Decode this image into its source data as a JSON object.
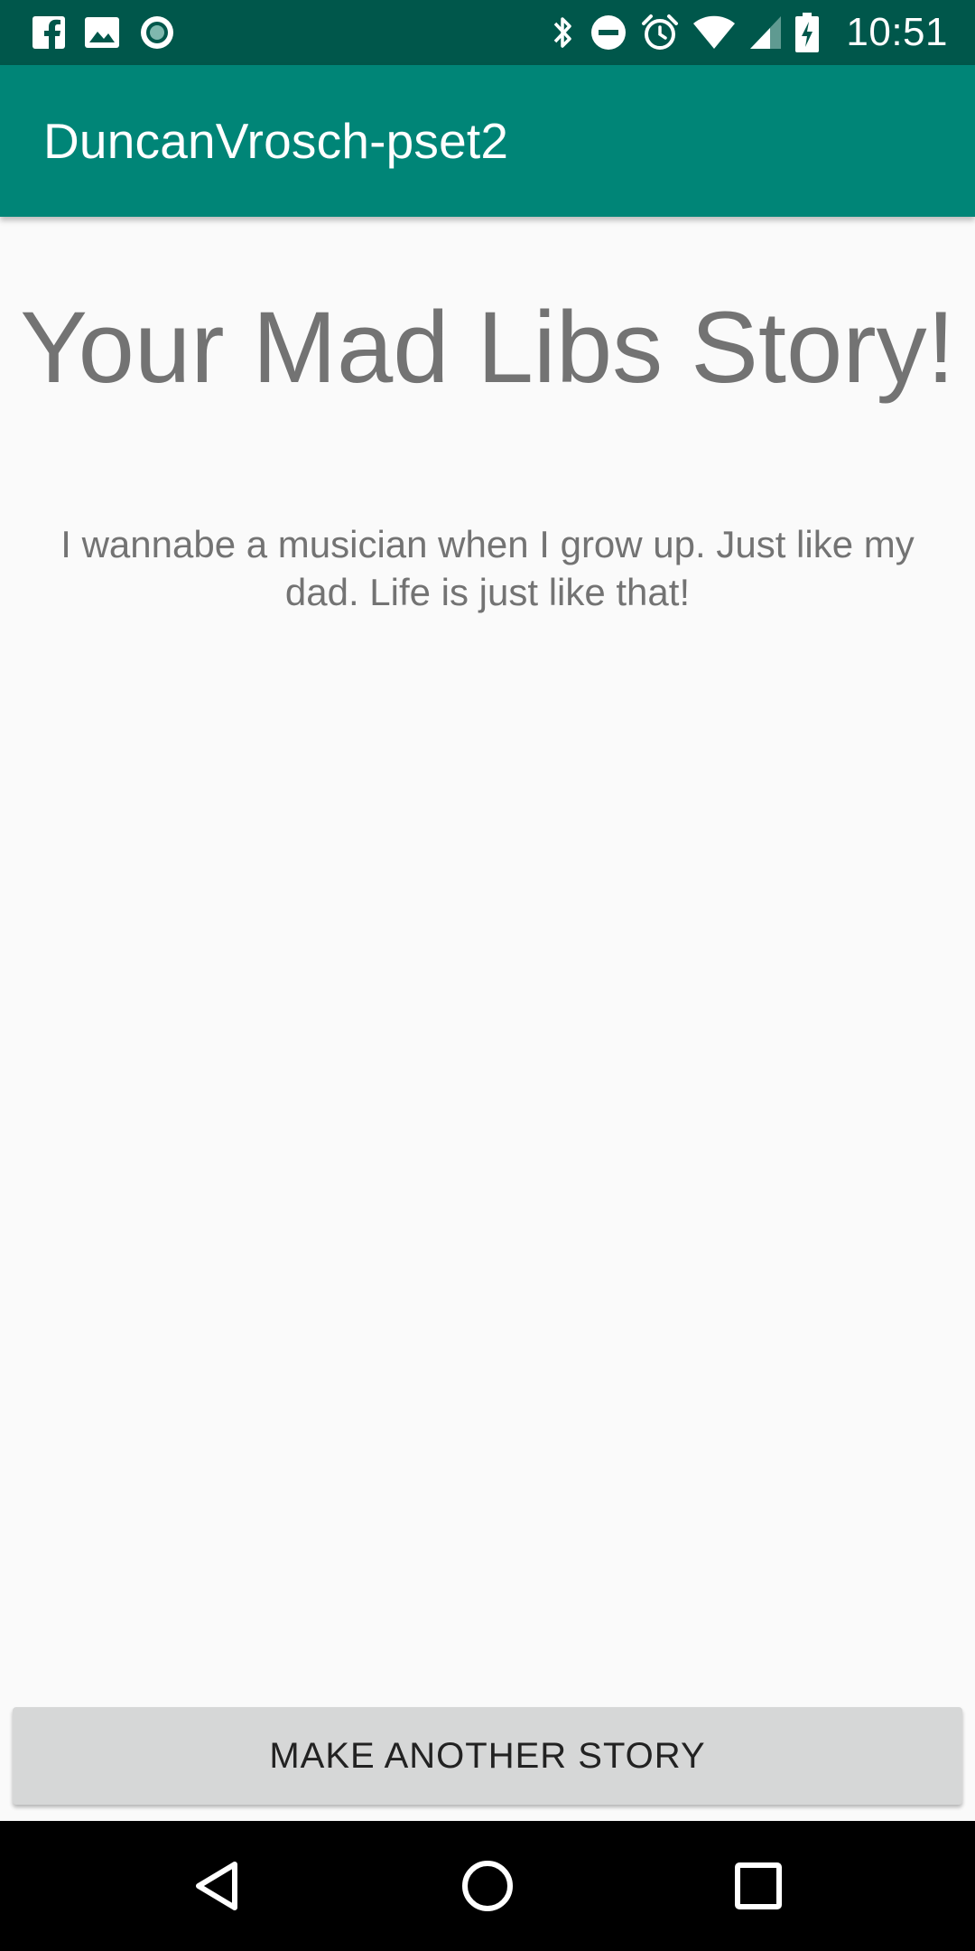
{
  "status_bar": {
    "time": "10:51",
    "left_icons": [
      "facebook-icon",
      "gallery-icon",
      "circle-app-icon"
    ],
    "right_icons": [
      "bluetooth-icon",
      "do-not-disturb-icon",
      "alarm-icon",
      "wifi-icon",
      "cell-signal-icon",
      "battery-charging-icon"
    ],
    "background": "#00574b"
  },
  "app_bar": {
    "title": "DuncanVrosch-pset2",
    "background": "#008577"
  },
  "story": {
    "heading": "Your Mad Libs Story!",
    "text": "I wannabe a musician when I grow up. Just like my dad. Life is just like that!"
  },
  "actions": {
    "make_another_label": "MAKE ANOTHER STORY"
  },
  "nav_bar": {
    "buttons": [
      "back-icon",
      "home-icon",
      "recents-icon"
    ]
  }
}
